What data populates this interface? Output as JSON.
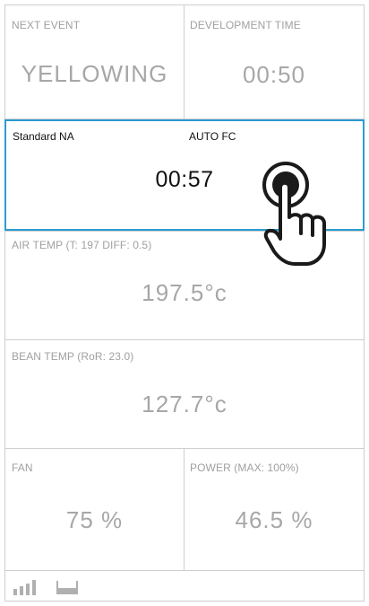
{
  "next_event": {
    "label": "NEXT EVENT",
    "value": "YELLOWING"
  },
  "development_time": {
    "label": "DEVELOPMENT TIME",
    "value": "00:50"
  },
  "active_panel": {
    "profile": "Standard NA",
    "mode": "AUTO FC",
    "timer": "00:57"
  },
  "air_temp": {
    "label": "AIR TEMP (T: 197 DIFF: 0.5)",
    "value": "197.5°c"
  },
  "bean_temp": {
    "label": "BEAN TEMP (RoR: 23.0)",
    "value": "127.7°c"
  },
  "fan": {
    "label": "FAN",
    "value": "75 %"
  },
  "power": {
    "label": "POWER (MAX: 100%)",
    "value": "46.5 %"
  },
  "footer": {
    "icons": [
      "signal-bars-icon",
      "tray-icon"
    ]
  },
  "colors": {
    "accent": "#2b9bd2",
    "label": "#a0a0a0",
    "value": "#a7a7a7",
    "border": "#cfcfcf"
  }
}
